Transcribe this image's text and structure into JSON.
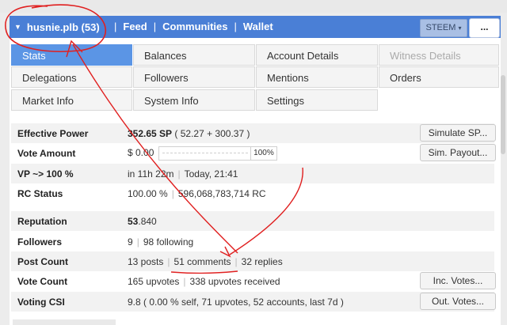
{
  "nav": {
    "account": "husnie.plb (53)",
    "links": [
      "Feed",
      "Communities",
      "Wallet"
    ],
    "steem_select": "STEEM",
    "more_button": "..."
  },
  "tabs": [
    {
      "label": "Stats",
      "state": "active"
    },
    {
      "label": "Balances",
      "state": "normal"
    },
    {
      "label": "Account Details",
      "state": "normal"
    },
    {
      "label": "Witness Details",
      "state": "disabled"
    },
    {
      "label": "Delegations",
      "state": "normal"
    },
    {
      "label": "Followers",
      "state": "normal"
    },
    {
      "label": "Mentions",
      "state": "normal"
    },
    {
      "label": "Orders",
      "state": "normal"
    },
    {
      "label": "Market Info",
      "state": "normal"
    },
    {
      "label": "System Info",
      "state": "normal"
    },
    {
      "label": "Settings",
      "state": "normal"
    }
  ],
  "stats": {
    "effective_power": {
      "label": "Effective Power",
      "value": "352.65 SP",
      "detail": "( 52.27 + 300.37 )",
      "button": "Simulate SP..."
    },
    "vote_amount": {
      "label": "Vote Amount",
      "value": "$ 0.00",
      "slider_percent": "100%",
      "button": "Sim. Payout..."
    },
    "vp": {
      "label": "VP ~> 100 %",
      "value": "in 11h 22m",
      "detail": "Today, 21:41"
    },
    "rc_status": {
      "label": "RC Status",
      "value": "100.00 %",
      "detail": "596,068,783,714 RC"
    },
    "reputation": {
      "label": "Reputation",
      "value_bold": "53",
      "value_rest": ".840"
    },
    "followers": {
      "label": "Followers",
      "value": "9",
      "detail": "98 following"
    },
    "post_count": {
      "label": "Post Count",
      "posts": "13 posts",
      "comments": "51 comments",
      "replies": "32 replies"
    },
    "vote_count": {
      "label": "Vote Count",
      "value": "165 upvotes",
      "detail": "338 upvotes received",
      "button": "Inc. Votes..."
    },
    "voting_csi": {
      "label": "Voting CSI",
      "value": "9.8 ( 0.00 % self, 71 upvotes, 52 accounts, last 7d )",
      "button": "Out. Votes..."
    }
  },
  "colors": {
    "navbar": "#4a7fd6",
    "active_tab": "#5b95e5",
    "annotation": "#e02020"
  }
}
